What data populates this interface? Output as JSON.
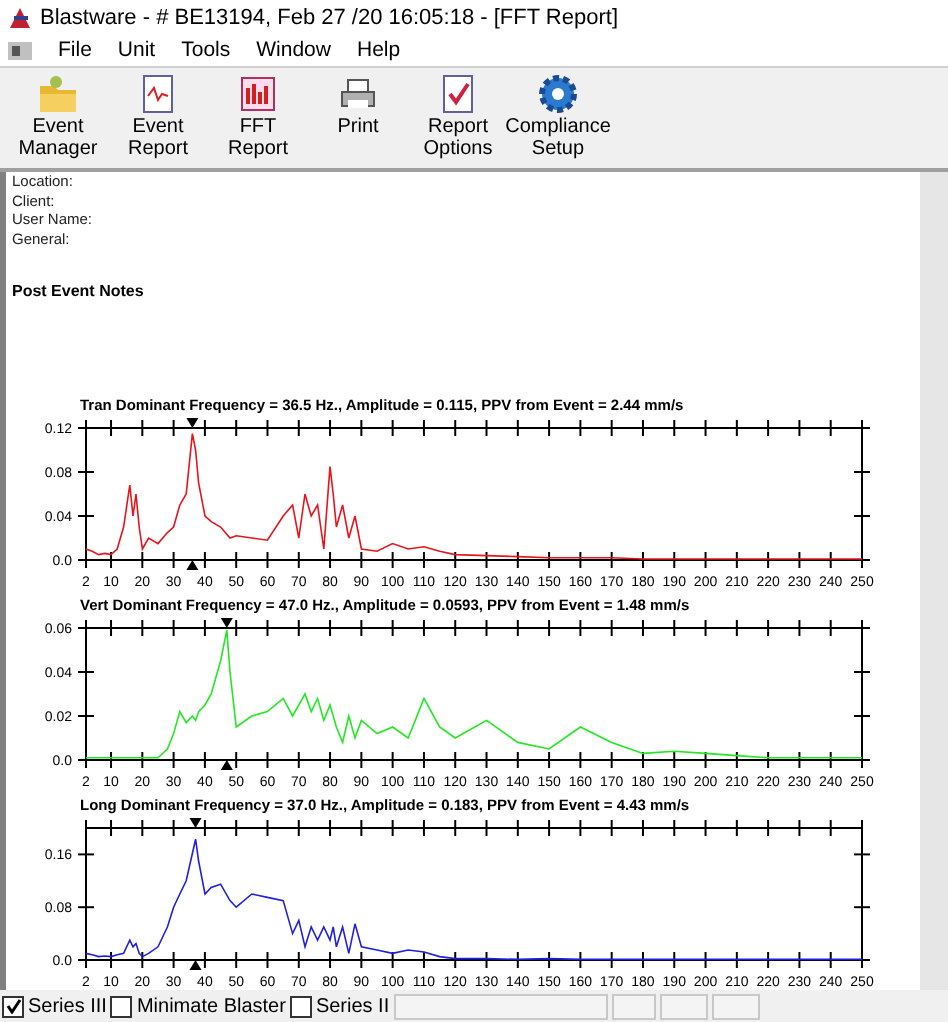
{
  "window": {
    "title": "Blastware - # BE13194, Feb 27 /20 16:05:18 - [FFT Report]"
  },
  "menu": [
    "File",
    "Unit",
    "Tools",
    "Window",
    "Help"
  ],
  "toolbar": [
    {
      "kind": "folder",
      "label": "Event\nManager"
    },
    {
      "kind": "report",
      "label": "Event\nReport"
    },
    {
      "kind": "fft",
      "label": "FFT\nReport"
    },
    {
      "kind": "print",
      "label": "Print"
    },
    {
      "kind": "check",
      "label": "Report\nOptions"
    },
    {
      "kind": "gear",
      "label": "Compliance\nSetup"
    }
  ],
  "info": [
    "Location:",
    "Client:",
    "User Name:",
    "General:"
  ],
  "notes_heading": "Post Event Notes",
  "charts": [
    {
      "title": "Tran Dominant Frequency = 36.5 Hz., Amplitude = 0.115,  PPV from Event = 2.44 mm/s",
      "chart_data": {
        "type": "line",
        "x": [
          2,
          4,
          6,
          8,
          10,
          12,
          14,
          16,
          17,
          18,
          19,
          20,
          22,
          25,
          28,
          30,
          32,
          34,
          36,
          37,
          38,
          40,
          42,
          45,
          48,
          50,
          55,
          60,
          65,
          68,
          70,
          72,
          74,
          76,
          78,
          80,
          81,
          82,
          84,
          86,
          88,
          90,
          95,
          100,
          105,
          110,
          115,
          120,
          130,
          140,
          150,
          160,
          170,
          180,
          190,
          200,
          210,
          220,
          230,
          240,
          250
        ],
        "series": [
          {
            "color": "#e8141c",
            "values": [
              0.01,
              0.008,
              0.005,
              0.006,
              0.005,
              0.01,
              0.03,
              0.068,
              0.04,
              0.06,
              0.03,
              0.01,
              0.02,
              0.015,
              0.025,
              0.03,
              0.05,
              0.06,
              0.115,
              0.1,
              0.07,
              0.04,
              0.035,
              0.03,
              0.02,
              0.022,
              0.02,
              0.018,
              0.04,
              0.05,
              0.02,
              0.06,
              0.04,
              0.05,
              0.01,
              0.085,
              0.06,
              0.03,
              0.05,
              0.02,
              0.04,
              0.01,
              0.008,
              0.015,
              0.01,
              0.012,
              0.008,
              0.005,
              0.004,
              0.003,
              0.002,
              0.002,
              0.002,
              0.001,
              0.001,
              0.001,
              0.001,
              0.001,
              0.001,
              0.001,
              0.001
            ]
          }
        ],
        "xlim": [
          2,
          250
        ],
        "ylim": [
          0,
          0.12
        ],
        "xticks": [
          2,
          10,
          20,
          30,
          40,
          50,
          60,
          70,
          80,
          90,
          100,
          110,
          120,
          130,
          140,
          150,
          160,
          170,
          180,
          190,
          200,
          210,
          220,
          230,
          240,
          250
        ],
        "yticks": [
          {
            "value": 0,
            "label": "0.0"
          },
          {
            "value": 0.04,
            "label": "0.04"
          },
          {
            "value": 0.08,
            "label": "0.08"
          },
          {
            "value": 0.12,
            "label": "0.12"
          }
        ]
      }
    },
    {
      "title": "Vert Dominant Frequency = 47.0 Hz., Amplitude = 0.0593,  PPV from Event = 1.48 mm/s",
      "chart_data": {
        "type": "line",
        "x": [
          2,
          4,
          6,
          8,
          10,
          12,
          14,
          16,
          17,
          18,
          19,
          20,
          22,
          25,
          28,
          30,
          32,
          34,
          36,
          37,
          38,
          40,
          42,
          45,
          47,
          48,
          50,
          55,
          60,
          65,
          68,
          70,
          72,
          74,
          76,
          78,
          80,
          81,
          82,
          84,
          86,
          88,
          90,
          95,
          100,
          105,
          110,
          115,
          120,
          130,
          140,
          150,
          160,
          170,
          180,
          190,
          200,
          210,
          220,
          230,
          240,
          250
        ],
        "series": [
          {
            "color": "#22e822",
            "values": [
              0.001,
              0.001,
              0.001,
              0.001,
              0.001,
              0.001,
              0.001,
              0.001,
              0.001,
              0.001,
              0.001,
              0.001,
              0.001,
              0.001,
              0.005,
              0.012,
              0.022,
              0.017,
              0.02,
              0.018,
              0.022,
              0.025,
              0.03,
              0.045,
              0.059,
              0.04,
              0.015,
              0.02,
              0.022,
              0.028,
              0.02,
              0.025,
              0.03,
              0.022,
              0.028,
              0.018,
              0.025,
              0.02,
              0.015,
              0.008,
              0.02,
              0.01,
              0.018,
              0.012,
              0.015,
              0.01,
              0.028,
              0.015,
              0.01,
              0.018,
              0.008,
              0.005,
              0.015,
              0.008,
              0.003,
              0.004,
              0.003,
              0.002,
              0.001,
              0.001,
              0.001,
              0.001
            ]
          }
        ],
        "xlim": [
          2,
          250
        ],
        "ylim": [
          0,
          0.06
        ],
        "xticks": [
          2,
          10,
          20,
          30,
          40,
          50,
          60,
          70,
          80,
          90,
          100,
          110,
          120,
          130,
          140,
          150,
          160,
          170,
          180,
          190,
          200,
          210,
          220,
          230,
          240,
          250
        ],
        "yticks": [
          {
            "value": 0,
            "label": "0.0"
          },
          {
            "value": 0.02,
            "label": "0.02"
          },
          {
            "value": 0.04,
            "label": "0.04"
          },
          {
            "value": 0.06,
            "label": "0.06"
          }
        ]
      }
    },
    {
      "title": "Long Dominant Frequency = 37.0 Hz., Amplitude = 0.183,  PPV from Event = 4.43 mm/s",
      "chart_data": {
        "type": "line",
        "x": [
          2,
          4,
          6,
          8,
          10,
          12,
          14,
          16,
          17,
          18,
          19,
          20,
          22,
          25,
          28,
          30,
          32,
          34,
          37,
          38,
          40,
          42,
          45,
          48,
          50,
          55,
          60,
          65,
          68,
          70,
          72,
          74,
          76,
          78,
          80,
          81,
          82,
          84,
          86,
          88,
          90,
          95,
          100,
          105,
          110,
          115,
          120,
          130,
          140,
          150,
          160,
          170,
          180,
          190,
          200,
          210,
          220,
          230,
          240,
          250
        ],
        "series": [
          {
            "color": "#2020e0",
            "values": [
              0.01,
              0.008,
              0.005,
              0.006,
              0.005,
              0.008,
              0.01,
              0.03,
              0.02,
              0.025,
              0.01,
              0.005,
              0.01,
              0.02,
              0.05,
              0.08,
              0.1,
              0.12,
              0.183,
              0.15,
              0.1,
              0.11,
              0.115,
              0.09,
              0.08,
              0.1,
              0.095,
              0.09,
              0.04,
              0.06,
              0.02,
              0.05,
              0.03,
              0.05,
              0.03,
              0.05,
              0.02,
              0.05,
              0.01,
              0.055,
              0.02,
              0.015,
              0.01,
              0.015,
              0.012,
              0.005,
              0.002,
              0.002,
              0.001,
              0.002,
              0.001,
              0.001,
              0.001,
              0.001,
              0.001,
              0.001,
              0.001,
              0.001,
              0.001,
              0.001
            ]
          }
        ],
        "xlim": [
          2,
          250
        ],
        "ylim": [
          0,
          0.2
        ],
        "xticks": [
          2,
          10,
          20,
          30,
          40,
          50,
          60,
          70,
          80,
          90,
          100,
          110,
          120,
          130,
          140,
          150,
          160,
          170,
          180,
          190,
          200,
          210,
          220,
          230,
          240,
          250
        ],
        "yticks": [
          {
            "value": 0,
            "label": "0.0"
          },
          {
            "value": 0.08,
            "label": "0.08"
          },
          {
            "value": 0.16,
            "label": "0.16"
          }
        ]
      }
    }
  ],
  "status": [
    {
      "label": "Series III",
      "checked": true
    },
    {
      "label": "Minimate Blaster",
      "checked": false
    },
    {
      "label": "Series II",
      "checked": false
    }
  ]
}
